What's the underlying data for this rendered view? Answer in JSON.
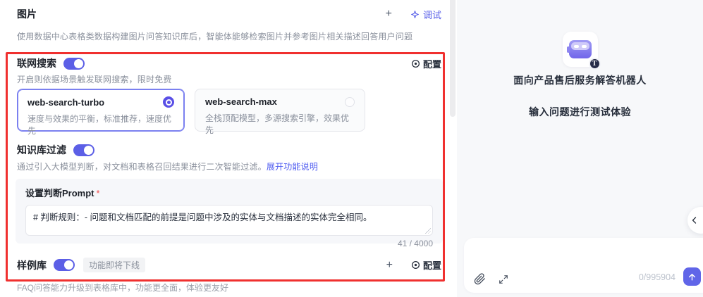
{
  "colors": {
    "accent": "#5c5fe6",
    "highlight_border": "#f0302f",
    "link": "#4d5af0",
    "right_panel_bg": "#f7f8fa"
  },
  "left_panel": {
    "image_section": {
      "title": "图片",
      "add_label": "+",
      "debug_label": "调试",
      "description": "使用数据中心表格类数据构建图片问答知识库后，智能体能够检索图片并参考图片相关描述回答用户问题"
    },
    "web_search": {
      "title": "联网搜索",
      "toggle_state": "on",
      "config_label": "配置",
      "description": "开启则依据场景触发联网搜索，限时免费",
      "options": [
        {
          "name": "web-search-turbo",
          "desc": "速度与效果的平衡，标准推荐，速度优先",
          "selected": true
        },
        {
          "name": "web-search-max",
          "desc": "全栈顶配模型，多源搜索引擎，效果优先",
          "selected": false
        }
      ]
    },
    "kb_filter": {
      "title": "知识库过滤",
      "toggle_state": "on",
      "description": "通过引入大模型判断，对文档和表格召回结果进行二次智能过滤。",
      "link_label": "展开功能说明",
      "prompt": {
        "label": "设置判断Prompt",
        "required_mark": "*",
        "value": "# 判断规则：- 问题和文档匹配的前提是问题中涉及的实体与文档描述的实体完全相同。",
        "counter": "41 / 4000"
      }
    },
    "sample_lib": {
      "title": "样例库",
      "toggle_state": "on",
      "badge": "功能即将下线",
      "add_label": "+",
      "config_label": "配置",
      "clipped_note": "FAQ问答能力升级到表格库中，功能更全面，体验更友好"
    }
  },
  "right_panel": {
    "bot_name": "面向产品售后服务解答机器人",
    "hint": "输入问题进行测试体验",
    "avatar_badge": "T",
    "chat_input": {
      "counter": "0/995904"
    }
  }
}
